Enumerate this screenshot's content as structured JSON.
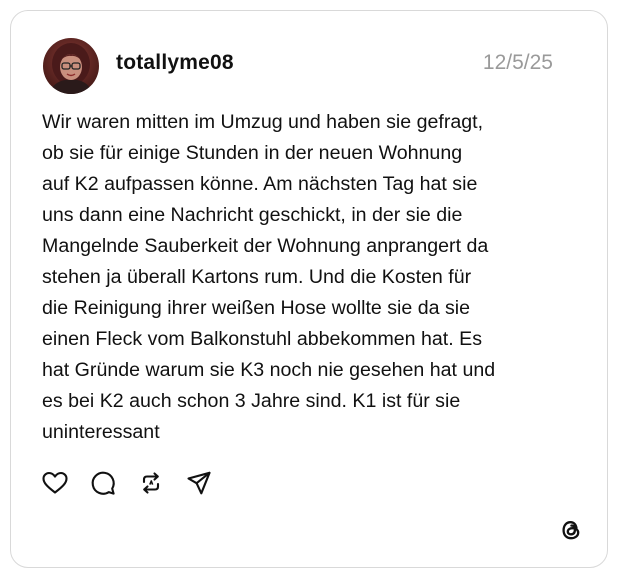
{
  "post": {
    "username": "totallyme08",
    "date": "12/5/25",
    "text_lines": [
      "Wir waren mitten im Umzug und haben sie gefragt,",
      "ob sie für einige Stunden in der neuen Wohnung",
      "auf K2 aufpassen könne. Am nächsten Tag hat sie",
      "uns dann eine Nachricht geschickt, in der sie die",
      "Mangelnde Sauberkeit der Wohnung anprangert da",
      "stehen ja überall Kartons rum. Und die Kosten für",
      "die Reinigung ihrer weißen Hose wollte sie da sie",
      "einen Fleck vom Balkonstuhl abbekommen hat. Es",
      "hat Gründe warum sie K3 noch nie gesehen hat und",
      "es bei K2 auch schon 3 Jahre sind. K1 ist für sie",
      "uninteressant"
    ]
  },
  "actions": {
    "icons": [
      "heart-icon",
      "comment-icon",
      "repost-icon",
      "share-icon"
    ]
  },
  "branding": {
    "icon": "threads-logo-icon"
  },
  "colors": {
    "text": "#111111",
    "muted": "#9a9a9a",
    "border": "#d9d9d9"
  }
}
